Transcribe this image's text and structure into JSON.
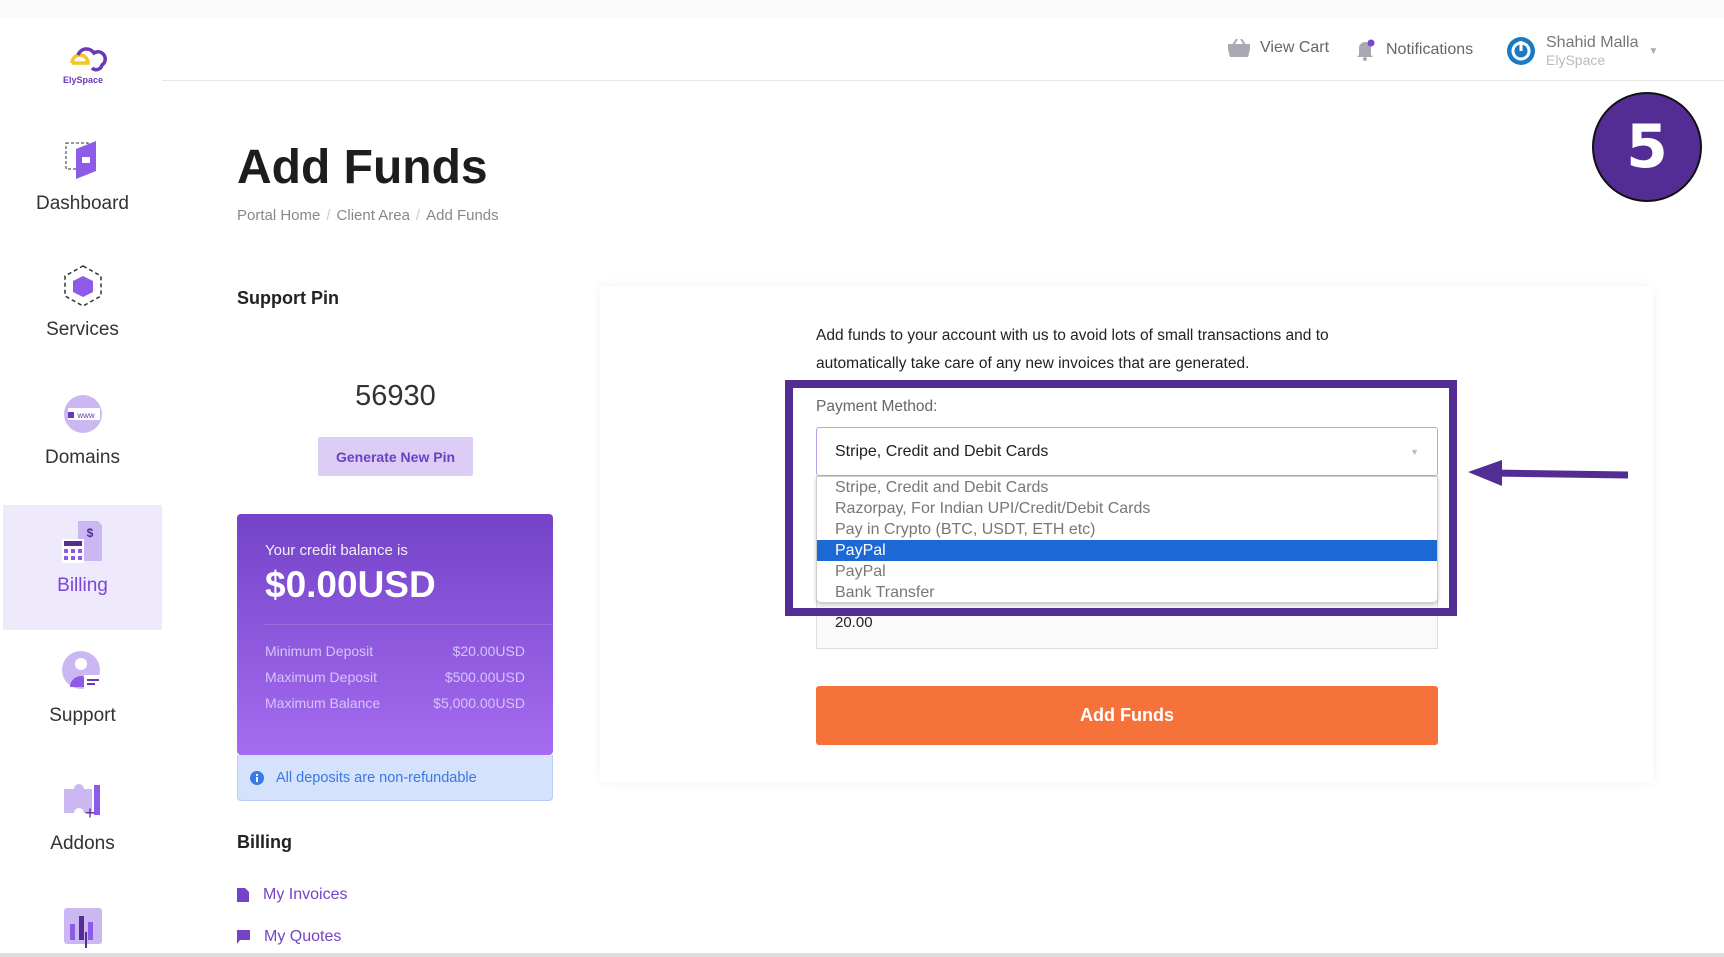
{
  "brand": {
    "logo_text": "ElySpace",
    "accent": "#7b45d6",
    "highlight": "#532d94",
    "cta": "#f5733a"
  },
  "sidebar": {
    "items": [
      {
        "label": "Dashboard",
        "icon": "dashboard-icon"
      },
      {
        "label": "Services",
        "icon": "cube-icon"
      },
      {
        "label": "Domains",
        "icon": "globe-www-icon"
      },
      {
        "label": "Billing",
        "icon": "billing-icon",
        "active": true
      },
      {
        "label": "Support",
        "icon": "support-agent-icon"
      },
      {
        "label": "Addons",
        "icon": "puzzle-icon"
      },
      {
        "label": "",
        "icon": "chart-icon"
      }
    ]
  },
  "header": {
    "view_cart": "View Cart",
    "notifications": "Notifications",
    "user_name": "Shahid Malla",
    "user_company": "ElySpace"
  },
  "step_badge": "5",
  "page": {
    "title": "Add Funds",
    "breadcrumb": [
      "Portal Home",
      "Client Area",
      "Add Funds"
    ]
  },
  "support_pin": {
    "heading": "Support Pin",
    "pin": "56930",
    "button": "Generate New Pin"
  },
  "credit": {
    "caption": "Your credit balance is",
    "balance": "$0.00USD",
    "rows": [
      {
        "label": "Minimum Deposit",
        "value": "$20.00USD"
      },
      {
        "label": "Maximum Deposit",
        "value": "$500.00USD"
      },
      {
        "label": "Maximum Balance",
        "value": "$5,000.00USD"
      }
    ],
    "notice": "All deposits are non-refundable"
  },
  "billing_nav": {
    "heading": "Billing",
    "links": [
      "My Invoices",
      "My Quotes"
    ]
  },
  "form": {
    "intro": "Add funds to your account with us to avoid lots of small transactions and to automatically take care of any new invoices that are generated.",
    "payment_label": "Payment Method:",
    "payment_selected": "Stripe, Credit and Debit Cards",
    "payment_options": [
      "Stripe, Credit and Debit Cards",
      "Razorpay, For Indian UPI/Credit/Debit Cards",
      "Pay in Crypto (BTC, USDT, ETH etc)",
      "PayPal",
      "PayPal",
      "Bank Transfer"
    ],
    "highlighted_option_index": 3,
    "amount": "20.00",
    "submit": "Add Funds"
  }
}
